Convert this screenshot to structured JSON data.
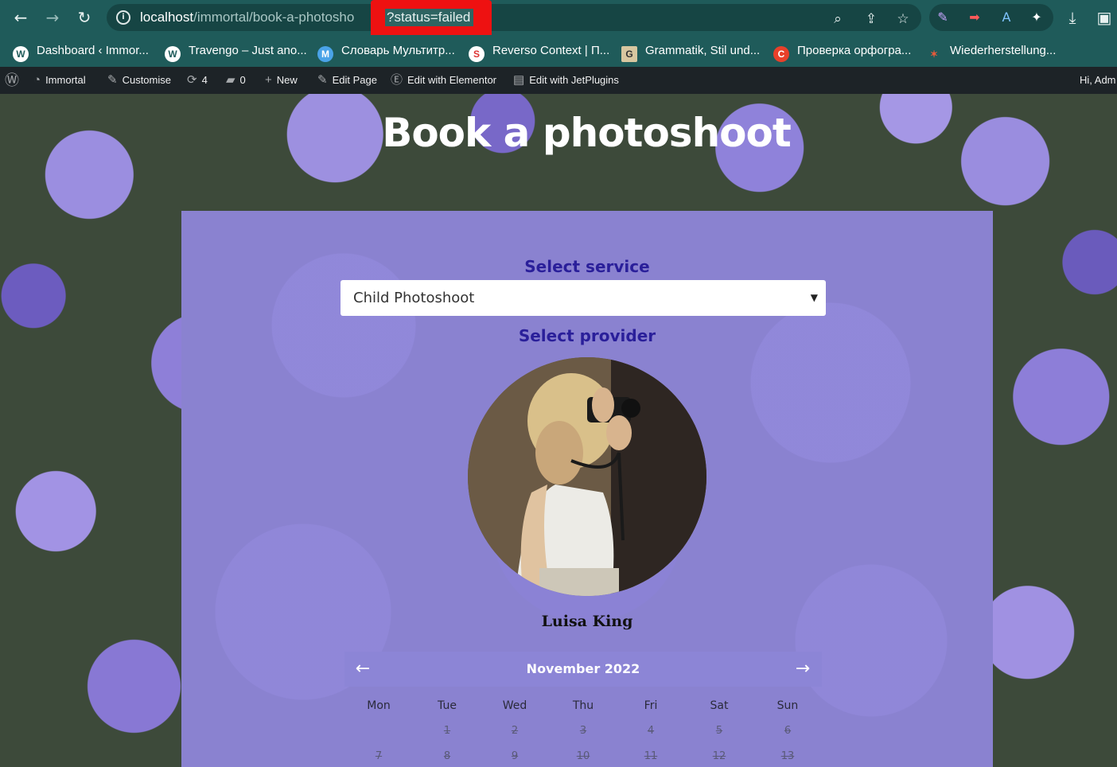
{
  "browser": {
    "url_host": "localhost",
    "url_path": "/immortal/book-a-photosho",
    "url_query": "?status=failed",
    "bookmarks": [
      {
        "label": "Dashboard ‹ Immor...",
        "icon": "wordpress-icon",
        "color": "#ffffff"
      },
      {
        "label": "Travengo – Just ano...",
        "icon": "wordpress-icon",
        "color": "#ffffff"
      },
      {
        "label": "Словарь Мультитр...",
        "icon": "multitran-icon",
        "color": "#4aa3e8"
      },
      {
        "label": "Reverso Context | П...",
        "icon": "reverso-icon",
        "color": "#ffffff"
      },
      {
        "label": "Grammatik, Stil und...",
        "icon": "grammatik-icon",
        "color": "#d8c7a0"
      },
      {
        "label": "Проверка орфогра...",
        "icon": "spellcheck-icon",
        "color": "#e8402a"
      },
      {
        "label": "Wiederherstellung...",
        "icon": "restore-icon",
        "color": "#e85a3a"
      }
    ]
  },
  "adminbar": {
    "site": "Immortal",
    "customise": "Customise",
    "updates": "4",
    "comments": "0",
    "new": "New",
    "edit_page": "Edit Page",
    "elementor": "Edit with Elementor",
    "jetplugins": "Edit with JetPlugins",
    "greeting": "Hi, Adm"
  },
  "page": {
    "title": "Book a photoshoot",
    "service_label": "Select service",
    "service_value": "Child Photoshoot",
    "provider_label": "Select provider",
    "provider_name": "Luisa King"
  },
  "calendar": {
    "month": "November 2022",
    "weekdays": [
      "Mon",
      "Tue",
      "Wed",
      "Thu",
      "Fri",
      "Sat",
      "Sun"
    ],
    "week1": [
      "",
      "1",
      "2",
      "3",
      "4",
      "5",
      "6"
    ],
    "week2": [
      "7",
      "8",
      "9",
      "10",
      "11",
      "12",
      "13"
    ]
  },
  "colors": {
    "chrome": "#1f5b5a",
    "adminbar": "#1d2327",
    "label": "#2a1f9a",
    "calendar_header": "#8c85d6",
    "highlight": "#ee1111"
  }
}
